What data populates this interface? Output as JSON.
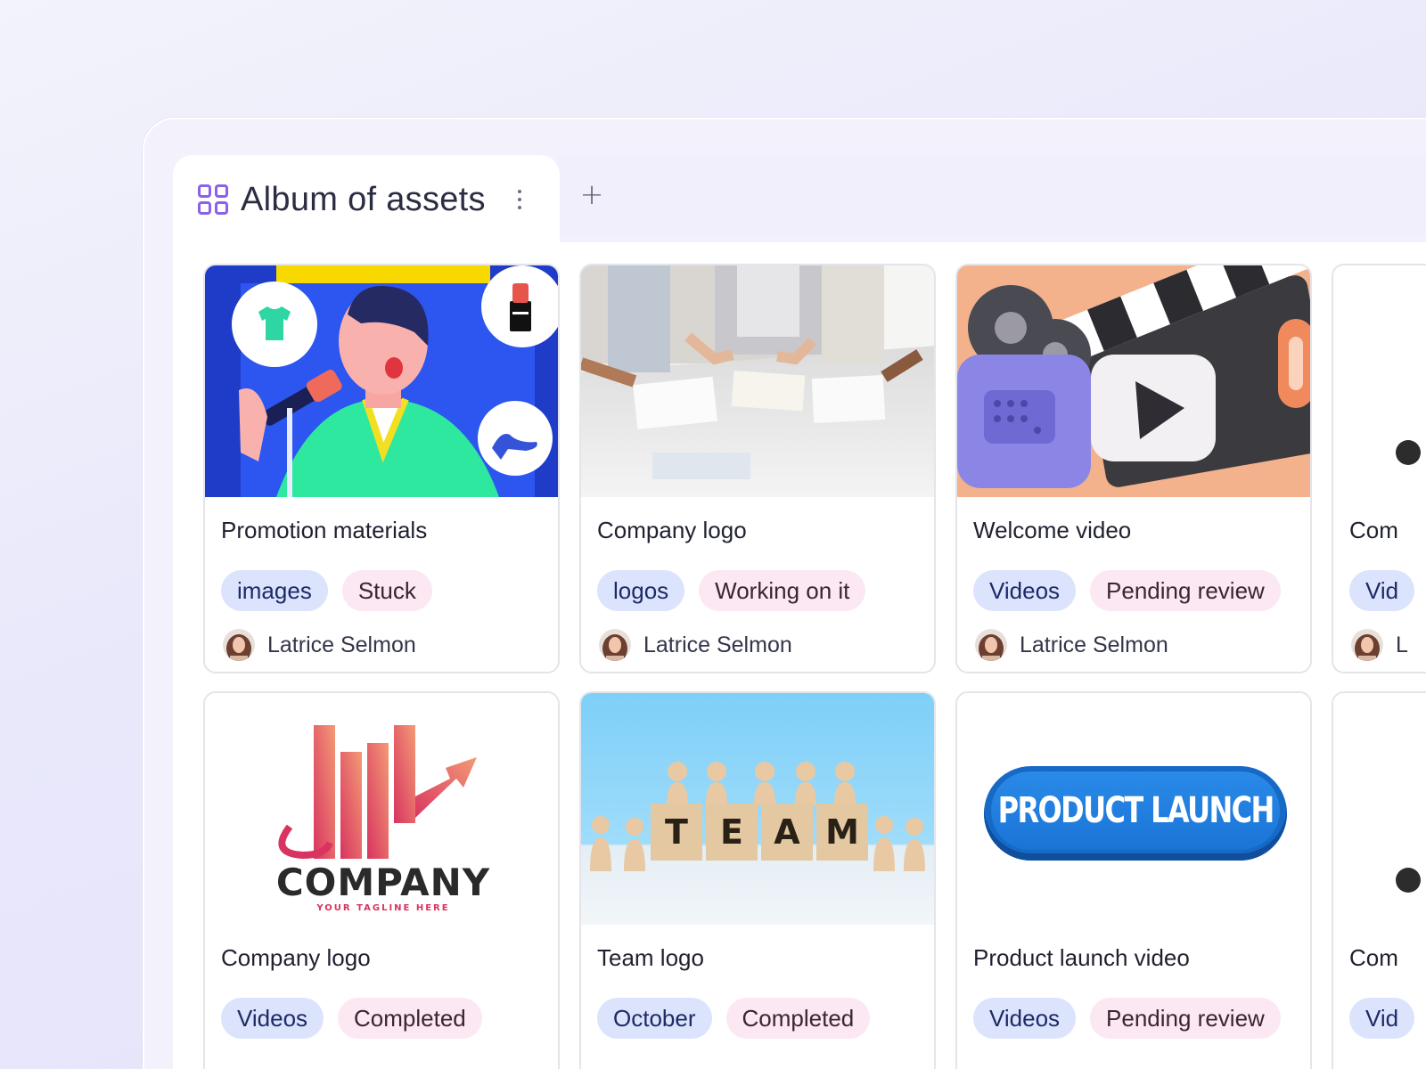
{
  "tab": {
    "title": "Album of assets",
    "add": "+"
  },
  "cards": [
    {
      "title": "Promotion materials",
      "category": "images",
      "status": "Stuck",
      "owner": "Latrice Selmon"
    },
    {
      "title": "Company logo",
      "category": "logos",
      "status": "Working on it",
      "owner": "Latrice Selmon"
    },
    {
      "title": "Welcome video",
      "category": "Videos",
      "status": "Pending review",
      "owner": "Latrice Selmon"
    },
    {
      "title": "Com",
      "category": "Vid",
      "owner_partial": "L"
    },
    {
      "title": "Company logo",
      "category": "Videos",
      "status": "Completed",
      "logo_word": "COMPANY",
      "logo_tagline": "YOUR TAGLINE HERE"
    },
    {
      "title": "Team logo",
      "category": "October",
      "status": "Completed",
      "blocks": [
        "T",
        "E",
        "A",
        "M"
      ]
    },
    {
      "title": "Product launch video",
      "category": "Videos",
      "status": "Pending review",
      "banner": "PRODUCT LAUNCH"
    },
    {
      "title": "Com",
      "category": "Vid"
    }
  ],
  "colors": {
    "accent": "#8a62e8",
    "category_tag": "#dce4fd",
    "status_tag": "#fbe8f2"
  }
}
